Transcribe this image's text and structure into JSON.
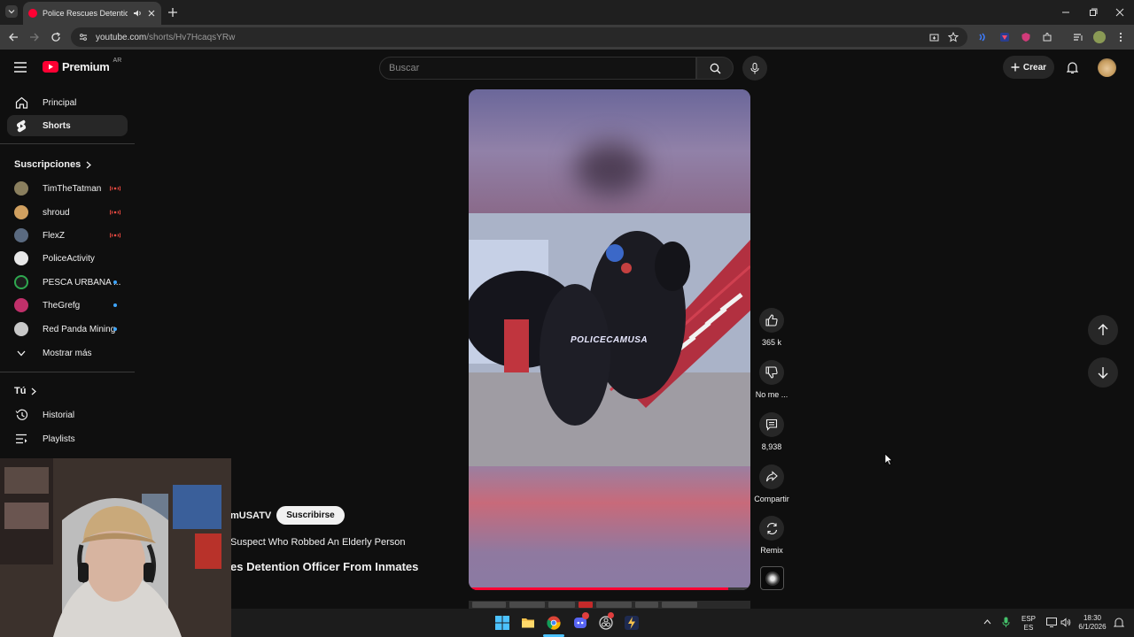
{
  "browser": {
    "tab_title": "Police Rescues Detention O",
    "url_host": "youtube.com",
    "url_path": "/shorts/Hv7HcaqsYRw"
  },
  "header": {
    "logo_text": "Premium",
    "region": "AR",
    "search_placeholder": "Buscar",
    "create_label": "Crear"
  },
  "sidebar": {
    "main": [
      {
        "label": "Principal",
        "icon": "home-icon"
      },
      {
        "label": "Shorts",
        "icon": "shorts-icon"
      }
    ],
    "subscriptions_title": "Suscripciones",
    "subscriptions": [
      {
        "label": "TimTheTatman",
        "status": "live",
        "color": "#8a7f5e"
      },
      {
        "label": "shroud",
        "status": "live",
        "color": "#d0a060"
      },
      {
        "label": "FlexZ",
        "status": "live",
        "color": "#5a6a80"
      },
      {
        "label": "PoliceActivity",
        "status": "none",
        "color": "#e8e8e8"
      },
      {
        "label": "PESCA URBANA ...",
        "status": "new",
        "color": "#2fa84f"
      },
      {
        "label": "TheGrefg",
        "status": "new",
        "color": "#c0306a"
      },
      {
        "label": "Red Panda Mining",
        "status": "new",
        "color": "#c8c8c8"
      }
    ],
    "show_more": "Mostrar más",
    "you_title": "Tú",
    "you_items": [
      {
        "label": "Historial",
        "icon": "history-icon"
      },
      {
        "label": "Playlists",
        "icon": "playlist-icon"
      }
    ]
  },
  "video": {
    "watermark": "POLICECAMUSA",
    "progress": 0.92,
    "channel": "mUSATV",
    "subscribe": "Suscribirse",
    "caption_line1": "Suspect Who Robbed An Elderly Person",
    "caption_line2": "es Detention Officer From Inmates"
  },
  "actions": {
    "likes": "365 k",
    "dislike": "No me ...",
    "comments": "8,938",
    "share": "Compartir",
    "remix": "Remix"
  },
  "taskbar": {
    "lang_top": "ESP",
    "lang_bottom": "ES",
    "time": "18:30",
    "date": "6/1/2026"
  },
  "colors": {
    "accent": "#ff0033",
    "bg": "#0f0f0f",
    "link": "#3ea6ff"
  }
}
